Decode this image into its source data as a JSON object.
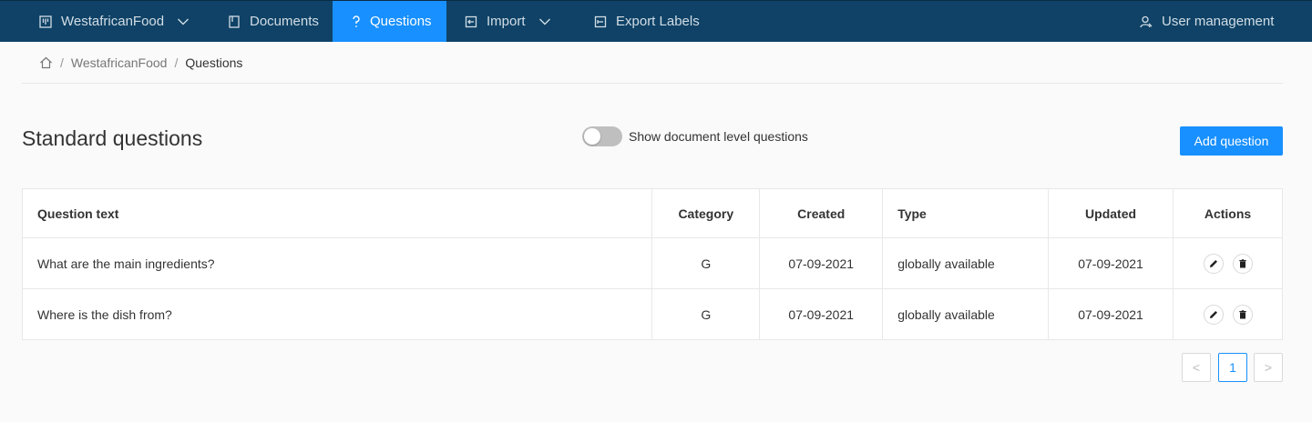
{
  "nav": {
    "project": {
      "label": "WestafricanFood",
      "icon": "project-board-icon"
    },
    "documents": {
      "label": "Documents",
      "icon": "document-icon"
    },
    "questions": {
      "label": "Questions",
      "icon": "question-icon"
    },
    "import": {
      "label": "Import",
      "icon": "import-icon"
    },
    "export": {
      "label": "Export Labels",
      "icon": "export-icon"
    },
    "user_management": {
      "label": "User management",
      "icon": "users-icon"
    }
  },
  "breadcrumb": {
    "project": "WestafricanFood",
    "separator": "/",
    "current": "Questions"
  },
  "page": {
    "title": "Standard questions",
    "toggle_label": "Show document level questions",
    "toggle_on": false,
    "add_button": "Add question"
  },
  "table": {
    "headers": {
      "question_text": "Question text",
      "category": "Category",
      "created": "Created",
      "type": "Type",
      "updated": "Updated",
      "actions": "Actions"
    },
    "rows": [
      {
        "question_text": "What are the main ingredients?",
        "category": "G",
        "created": "07-09-2021",
        "type": "globally available",
        "updated": "07-09-2021"
      },
      {
        "question_text": "Where is the dish from?",
        "category": "G",
        "created": "07-09-2021",
        "type": "globally available",
        "updated": "07-09-2021"
      }
    ]
  },
  "pagination": {
    "prev": "<",
    "current": "1",
    "next": ">"
  },
  "colors": {
    "topbar": "#0f4266",
    "accent": "#1890ff",
    "nav_text": "#d2dde6"
  }
}
